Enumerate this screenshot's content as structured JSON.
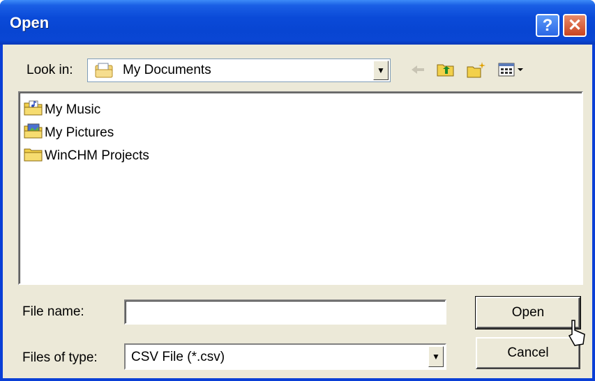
{
  "window": {
    "title": "Open"
  },
  "titlebar": {
    "help_glyph": "?",
    "close_glyph": "✕"
  },
  "look_in": {
    "label": "Look in:",
    "value": "My Documents"
  },
  "toolbar": {
    "icons": [
      "back-icon",
      "up-folder-icon",
      "new-folder-icon",
      "view-menu-icon"
    ]
  },
  "files": [
    {
      "name": "My Music",
      "icon": "music-folder-icon"
    },
    {
      "name": "My Pictures",
      "icon": "pictures-folder-icon"
    },
    {
      "name": "WinCHM Projects",
      "icon": "folder-icon"
    }
  ],
  "file_name": {
    "label": "File name:",
    "value": ""
  },
  "file_type": {
    "label": "Files of type:",
    "value": "CSV File (*.csv)"
  },
  "buttons": {
    "open": "Open",
    "cancel": "Cancel"
  },
  "colors": {
    "title_bar": "#0a4ad8",
    "dialog_bg": "#ece9d8",
    "close": "#c94420"
  }
}
